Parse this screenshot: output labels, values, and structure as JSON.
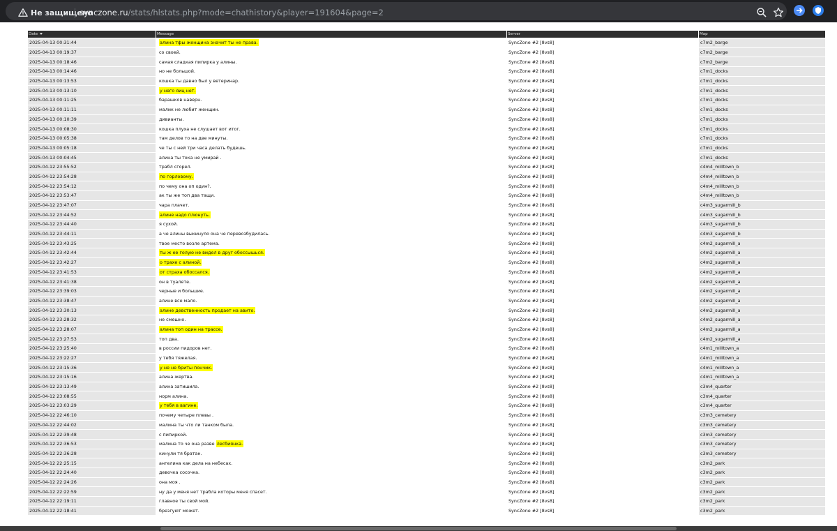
{
  "browser": {
    "security_label": "Не защищено",
    "url_host": "synczone.ru",
    "url_path": "/stats/hlstats.php?mode=chathistory&player=191604&page=2",
    "accent_blue": "#4c8bf5"
  },
  "table": {
    "columns": [
      "Date",
      "Message",
      "Server",
      "Map"
    ],
    "sort_column": "Date",
    "rows": [
      {
        "date": "2025-04-13 00:31:44",
        "msg_pre": "",
        "msg_hl": "алина тфы женщина значит ты не права.",
        "msg_post": "",
        "server": "SyncZone #2 [8vs8]",
        "map": "c7m2_barge"
      },
      {
        "date": "2025-04-13 00:19:37",
        "msg_pre": "со своей.",
        "msg_hl": "",
        "msg_post": "",
        "server": "SyncZone #2 [8vs8]",
        "map": "c7m2_barge"
      },
      {
        "date": "2025-04-13 00:18:46",
        "msg_pre": "самая сладкая пипирка у алины.",
        "msg_hl": "",
        "msg_post": "",
        "server": "SyncZone #2 [8vs8]",
        "map": "c7m2_barge"
      },
      {
        "date": "2025-04-13 00:14:46",
        "msg_pre": "но не большой.",
        "msg_hl": "",
        "msg_post": "",
        "server": "SyncZone #2 [8vs8]",
        "map": "c7m1_docks"
      },
      {
        "date": "2025-04-13 00:13:53",
        "msg_pre": "кошка ты давно был у ветеринар.",
        "msg_hl": "",
        "msg_post": "",
        "server": "SyncZone #2 [8vs8]",
        "map": "c7m1_docks"
      },
      {
        "date": "2025-04-13 00:13:10",
        "msg_pre": "",
        "msg_hl": "у него яиц нет.",
        "msg_post": "",
        "server": "SyncZone #2 [8vs8]",
        "map": "c7m1_docks"
      },
      {
        "date": "2025-04-13 00:11:25",
        "msg_pre": "барашков наверн.",
        "msg_hl": "",
        "msg_post": "",
        "server": "SyncZone #2 [8vs8]",
        "map": "c7m1_docks"
      },
      {
        "date": "2025-04-13 00:11:11",
        "msg_pre": "малик не любит женщин.",
        "msg_hl": "",
        "msg_post": "",
        "server": "SyncZone #2 [8vs8]",
        "map": "c7m1_docks"
      },
      {
        "date": "2025-04-13 00:10:39",
        "msg_pre": "дивианты.",
        "msg_hl": "",
        "msg_post": "",
        "server": "SyncZone #2 [8vs8]",
        "map": "c7m1_docks"
      },
      {
        "date": "2025-04-13 00:08:30",
        "msg_pre": "кошка плуха не слушает вот итог.",
        "msg_hl": "",
        "msg_post": "",
        "server": "SyncZone #2 [8vs8]",
        "map": "c7m1_docks"
      },
      {
        "date": "2025-04-13 00:05:38",
        "msg_pre": "там делов то на две минуты.",
        "msg_hl": "",
        "msg_post": "",
        "server": "SyncZone #2 [8vs8]",
        "map": "c7m1_docks"
      },
      {
        "date": "2025-04-13 00:05:18",
        "msg_pre": "че ты с ней три часа делать будешь.",
        "msg_hl": "",
        "msg_post": "",
        "server": "SyncZone #2 [8vs8]",
        "map": "c7m1_docks"
      },
      {
        "date": "2025-04-13 00:04:45",
        "msg_pre": "алина ты тока не умирай .",
        "msg_hl": "",
        "msg_post": "",
        "server": "SyncZone #2 [8vs8]",
        "map": "c7m1_docks"
      },
      {
        "date": "2025-04-12 23:55:52",
        "msg_pre": "трабл сгорел.",
        "msg_hl": "",
        "msg_post": "",
        "server": "SyncZone #2 [8vs8]",
        "map": "c4m4_milltown_b"
      },
      {
        "date": "2025-04-12 23:54:28",
        "msg_pre": "",
        "msg_hl": "по горловому.",
        "msg_post": "",
        "server": "SyncZone #2 [8vs8]",
        "map": "c4m4_milltown_b"
      },
      {
        "date": "2025-04-12 23:54:12",
        "msg_pre": "по чему она оп один?.",
        "msg_hl": "",
        "msg_post": "",
        "server": "SyncZone #2 [8vs8]",
        "map": "c4m4_milltown_b"
      },
      {
        "date": "2025-04-12 23:53:47",
        "msg_pre": "ак ты же топ два тащи.",
        "msg_hl": "",
        "msg_post": "",
        "server": "SyncZone #2 [8vs8]",
        "map": "c4m4_milltown_b"
      },
      {
        "date": "2025-04-12 23:47:07",
        "msg_pre": "чара плачет.",
        "msg_hl": "",
        "msg_post": "",
        "server": "SyncZone #2 [8vs8]",
        "map": "c4m3_sugarmill_b"
      },
      {
        "date": "2025-04-12 23:44:52",
        "msg_pre": "",
        "msg_hl": "алине надо плюнуть.",
        "msg_post": "",
        "server": "SyncZone #2 [8vs8]",
        "map": "c4m3_sugarmill_b"
      },
      {
        "date": "2025-04-12 23:44:40",
        "msg_pre": "я сухой.",
        "msg_hl": "",
        "msg_post": "",
        "server": "SyncZone #2 [8vs8]",
        "map": "c4m3_sugarmill_b"
      },
      {
        "date": "2025-04-12 23:44:11",
        "msg_pre": "а че алины выкинуло она че перевозбудилась.",
        "msg_hl": "",
        "msg_post": "",
        "server": "SyncZone #2 [8vs8]",
        "map": "c4m3_sugarmill_b"
      },
      {
        "date": "2025-04-12 23:43:25",
        "msg_pre": "твое место возле артема.",
        "msg_hl": "",
        "msg_post": "",
        "server": "SyncZone #2 [8vs8]",
        "map": "c4m2_sugarmill_a"
      },
      {
        "date": "2025-04-12 23:42:44",
        "msg_pre": "",
        "msg_hl": "ты ж ее голую не видел в друг обоссышься.",
        "msg_post": "",
        "server": "SyncZone #2 [8vs8]",
        "map": "c4m2_sugarmill_a"
      },
      {
        "date": "2025-04-12 23:42:27",
        "msg_pre": "",
        "msg_hl": "о трахе с алиной.",
        "msg_post": "",
        "server": "SyncZone #2 [8vs8]",
        "map": "c4m2_sugarmill_a"
      },
      {
        "date": "2025-04-12 23:41:53",
        "msg_pre": "",
        "msg_hl": "от страха обоссался.",
        "msg_post": "",
        "server": "SyncZone #2 [8vs8]",
        "map": "c4m2_sugarmill_a"
      },
      {
        "date": "2025-04-12 23:41:38",
        "msg_pre": "он в туалете.",
        "msg_hl": "",
        "msg_post": "",
        "server": "SyncZone #2 [8vs8]",
        "map": "c4m2_sugarmill_a"
      },
      {
        "date": "2025-04-12 23:39:03",
        "msg_pre": "черные и большие.",
        "msg_hl": "",
        "msg_post": "",
        "server": "SyncZone #2 [8vs8]",
        "map": "c4m2_sugarmill_a"
      },
      {
        "date": "2025-04-12 23:38:47",
        "msg_pre": "алине все мало.",
        "msg_hl": "",
        "msg_post": "",
        "server": "SyncZone #2 [8vs8]",
        "map": "c4m2_sugarmill_a"
      },
      {
        "date": "2025-04-12 23:30:13",
        "msg_pre": "",
        "msg_hl": "алине девственность продает на авито.",
        "msg_post": "",
        "server": "SyncZone #2 [8vs8]",
        "map": "c4m2_sugarmill_a"
      },
      {
        "date": "2025-04-12 23:28:32",
        "msg_pre": "не смешно.",
        "msg_hl": "",
        "msg_post": "",
        "server": "SyncZone #2 [8vs8]",
        "map": "c4m2_sugarmill_a"
      },
      {
        "date": "2025-04-12 23:28:07",
        "msg_pre": "",
        "msg_hl": "алина топ один на трассе.",
        "msg_post": "",
        "server": "SyncZone #2 [8vs8]",
        "map": "c4m2_sugarmill_a"
      },
      {
        "date": "2025-04-12 23:27:53",
        "msg_pre": "топ два.",
        "msg_hl": "",
        "msg_post": "",
        "server": "SyncZone #2 [8vs8]",
        "map": "c4m2_sugarmill_a"
      },
      {
        "date": "2025-04-12 23:25:40",
        "msg_pre": "в россии пидоров нет.",
        "msg_hl": "",
        "msg_post": "",
        "server": "SyncZone #2 [8vs8]",
        "map": "c4m1_milltown_a"
      },
      {
        "date": "2025-04-12 23:22:27",
        "msg_pre": "у тебя тяжелая.",
        "msg_hl": "",
        "msg_post": "",
        "server": "SyncZone #2 [8vs8]",
        "map": "c4m1_milltown_a"
      },
      {
        "date": "2025-04-12 23:15:36",
        "msg_pre": "",
        "msg_hl": "у не не бриты пончик.",
        "msg_post": "",
        "server": "SyncZone #2 [8vs8]",
        "map": "c4m1_milltown_a"
      },
      {
        "date": "2025-04-12 23:15:16",
        "msg_pre": "алина жертва.",
        "msg_hl": "",
        "msg_post": "",
        "server": "SyncZone #2 [8vs8]",
        "map": "c4m1_milltown_a"
      },
      {
        "date": "2025-04-12 23:13:49",
        "msg_pre": "алина затишила.",
        "msg_hl": "",
        "msg_post": "",
        "server": "SyncZone #2 [8vs8]",
        "map": "c3m4_quarter"
      },
      {
        "date": "2025-04-12 23:08:55",
        "msg_pre": "норм алина.",
        "msg_hl": "",
        "msg_post": "",
        "server": "SyncZone #2 [8vs8]",
        "map": "c3m4_quarter"
      },
      {
        "date": "2025-04-12 23:03:29",
        "msg_pre": "",
        "msg_hl": "у тебя в вагине.",
        "msg_post": "",
        "server": "SyncZone #2 [8vs8]",
        "map": "c3m4_quarter"
      },
      {
        "date": "2025-04-12 22:46:10",
        "msg_pre": "почему четыре плевы .",
        "msg_hl": "",
        "msg_post": "",
        "server": "SyncZone #2 [8vs8]",
        "map": "c3m3_cemetery"
      },
      {
        "date": "2025-04-12 22:44:02",
        "msg_pre": "малина ты что ли танком была.",
        "msg_hl": "",
        "msg_post": "",
        "server": "SyncZone #2 [8vs8]",
        "map": "c3m3_cemetery"
      },
      {
        "date": "2025-04-12 22:39:48",
        "msg_pre": "с пипиркой.",
        "msg_hl": "",
        "msg_post": "",
        "server": "SyncZone #2 [8vs8]",
        "map": "c3m3_cemetery"
      },
      {
        "date": "2025-04-12 22:36:53",
        "msg_pre": "малина то че она разве ",
        "msg_hl": "лесбиянка.",
        "msg_post": "",
        "server": "SyncZone #2 [8vs8]",
        "map": "c3m3_cemetery"
      },
      {
        "date": "2025-04-12 22:36:28",
        "msg_pre": "кинули тя братан.",
        "msg_hl": "",
        "msg_post": "",
        "server": "SyncZone #2 [8vs8]",
        "map": "c3m3_cemetery"
      },
      {
        "date": "2025-04-12 22:25:15",
        "msg_pre": "ангелина как дела на небесах.",
        "msg_hl": "",
        "msg_post": "",
        "server": "SyncZone #2 [8vs8]",
        "map": "c3m2_park"
      },
      {
        "date": "2025-04-12 22:24:40",
        "msg_pre": "девочка сосочка.",
        "msg_hl": "",
        "msg_post": "",
        "server": "SyncZone #2 [8vs8]",
        "map": "c3m2_park"
      },
      {
        "date": "2025-04-12 22:24:26",
        "msg_pre": "она моя .",
        "msg_hl": "",
        "msg_post": "",
        "server": "SyncZone #2 [8vs8]",
        "map": "c3m2_park"
      },
      {
        "date": "2025-04-12 22:22:59",
        "msg_pre": "ну да у меня нет трабла которы меня спасет.",
        "msg_hl": "",
        "msg_post": "",
        "server": "SyncZone #2 [8vs8]",
        "map": "c3m2_park"
      },
      {
        "date": "2025-04-12 22:19:11",
        "msg_pre": "главное ты свой мой.",
        "msg_hl": "",
        "msg_post": "",
        "server": "SyncZone #2 [8vs8]",
        "map": "c3m2_park"
      },
      {
        "date": "2025-04-12 22:18:41",
        "msg_pre": "брезгуют может.",
        "msg_hl": "",
        "msg_post": "",
        "server": "SyncZone #2 [8vs8]",
        "map": "c3m2_park"
      }
    ]
  }
}
